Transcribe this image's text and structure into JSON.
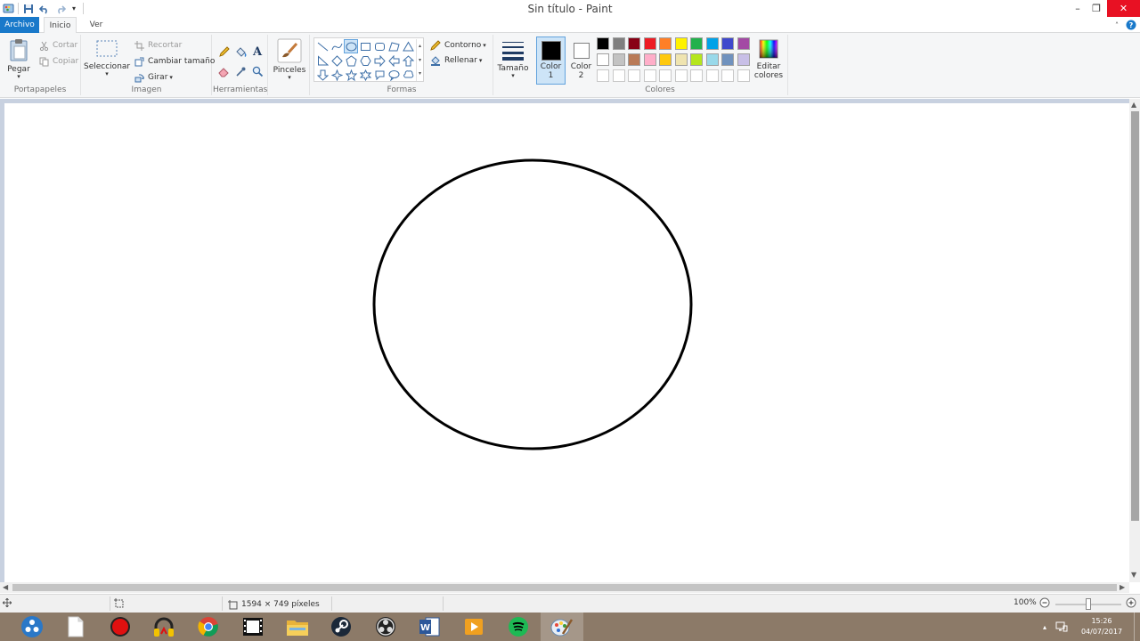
{
  "window": {
    "title": "Sin título - Paint",
    "minimize_glyph": "–",
    "restore_glyph": "❐",
    "close_glyph": "✕"
  },
  "tabs": {
    "file": "Archivo",
    "home": "Inicio",
    "view": "Ver"
  },
  "ribbon": {
    "clipboard": {
      "label": "Portapapeles",
      "paste": "Pegar",
      "cut": "Cortar",
      "copy": "Copiar"
    },
    "image": {
      "label": "Imagen",
      "select": "Seleccionar",
      "crop": "Recortar",
      "resize": "Cambiar tamaño",
      "rotate": "Girar"
    },
    "tools": {
      "label": "Herramientas",
      "text_glyph": "A"
    },
    "brushes": {
      "label": "Pinceles"
    },
    "shapes": {
      "label": "Formas",
      "outline": "Contorno",
      "fill": "Rellenar",
      "selected_shape": "oval"
    },
    "size": {
      "label": "Tamaño"
    },
    "colors": {
      "label": "Colores",
      "color1_label": "Color",
      "color1_num": "1",
      "color2_label": "Color",
      "color2_num": "2",
      "color1": "#000000",
      "color2": "#ffffff",
      "edit_label": "Editar",
      "edit_label2": "colores",
      "palette_row1": [
        "#000000",
        "#7f7f7f",
        "#880015",
        "#ed1c24",
        "#ff7f27",
        "#fff200",
        "#22b14c",
        "#00a2e8",
        "#3f48cc",
        "#a349a4"
      ],
      "palette_row2": [
        "#ffffff",
        "#c3c3c3",
        "#b97a57",
        "#ffaec9",
        "#ffc90e",
        "#efe4b0",
        "#b5e61d",
        "#99d9ea",
        "#7092be",
        "#c8bfe7"
      ],
      "palette_row3": [
        "#ffffff",
        "#ffffff",
        "#ffffff",
        "#ffffff",
        "#ffffff",
        "#ffffff",
        "#ffffff",
        "#ffffff",
        "#ffffff",
        "#ffffff"
      ]
    }
  },
  "status": {
    "dimensions": "1594 × 749 píxeles",
    "zoom": "100%",
    "zoom_level": 1.0
  },
  "taskbar": {
    "apps": [
      "start",
      "file",
      "record",
      "headphones",
      "chrome",
      "film",
      "explorer",
      "steam",
      "obs",
      "word",
      "video",
      "spotify",
      "paint"
    ],
    "active": "paint"
  },
  "clock": {
    "time": "15:26",
    "date": "04/07/2017"
  },
  "colors": {
    "accent": "#1979ca",
    "close": "#e81123"
  }
}
